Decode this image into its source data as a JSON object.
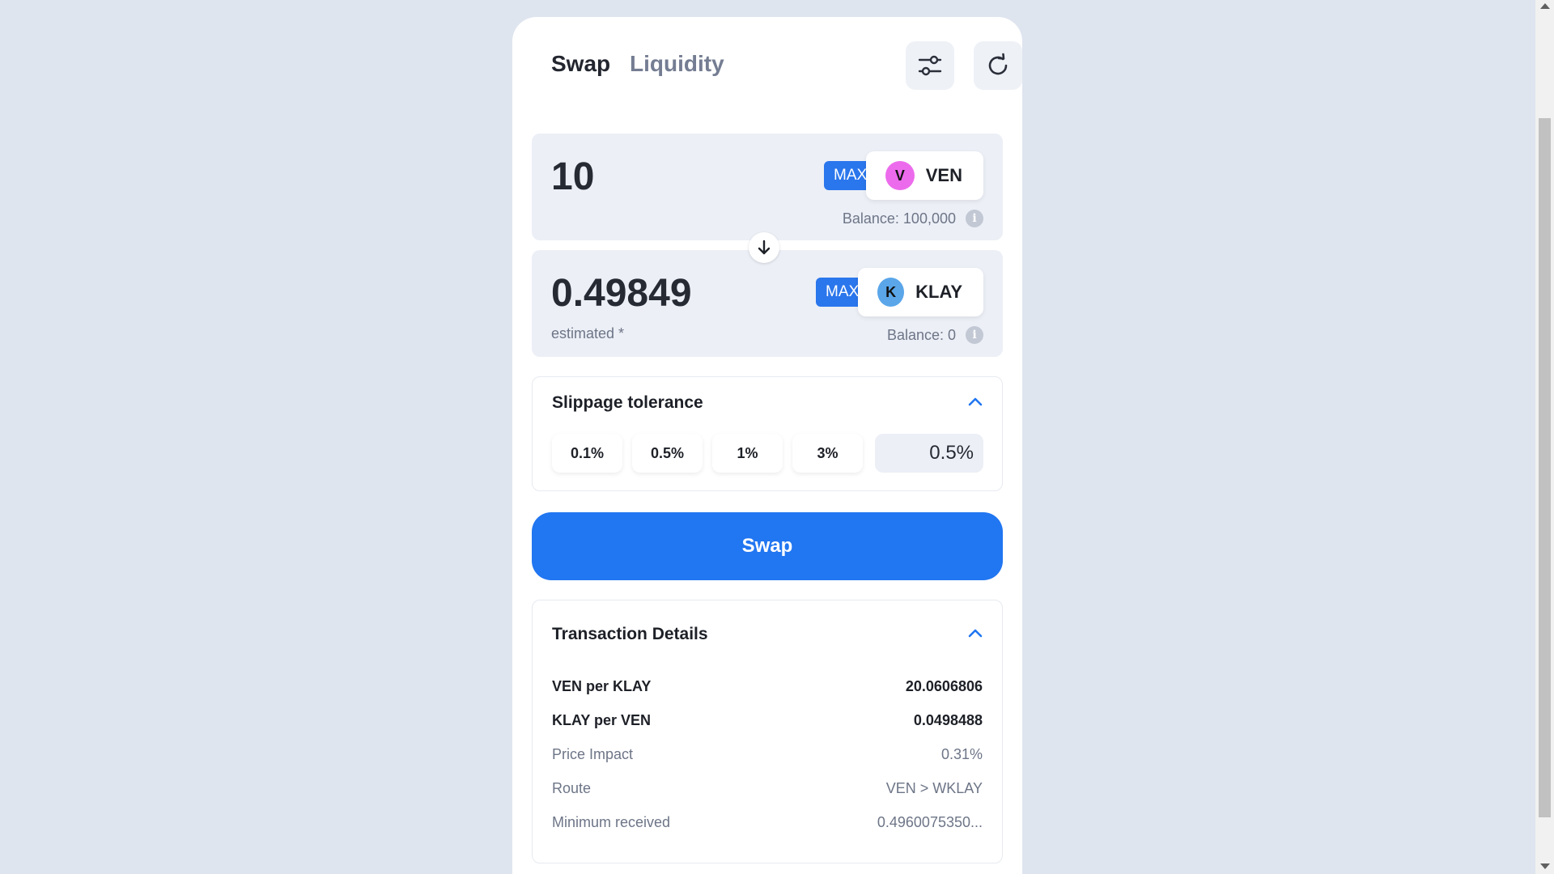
{
  "tabs": {
    "swap": "Swap",
    "liquidity": "Liquidity"
  },
  "from": {
    "amount": "10",
    "max_label": "MAX",
    "token": {
      "symbol": "VEN",
      "letter": "V",
      "color": "#ec6bec"
    },
    "balance": "Balance: 100,000"
  },
  "to": {
    "amount": "0.49849",
    "max_label": "MAX",
    "token": {
      "symbol": "KLAY",
      "letter": "K",
      "color": "#5aa6e9"
    },
    "estimated": "estimated *",
    "balance": "Balance: 0"
  },
  "slippage": {
    "title": "Slippage tolerance",
    "options": [
      "0.1%",
      "0.5%",
      "1%",
      "3%"
    ],
    "value": "0.5%"
  },
  "swap_button": "Swap",
  "details": {
    "title": "Transaction Details",
    "rows": [
      {
        "label": "VEN per KLAY",
        "value": "20.0606806"
      },
      {
        "label": "KLAY per VEN",
        "value": "0.0498488"
      },
      {
        "label": "Price Impact",
        "value": "0.31%"
      },
      {
        "label": "Route",
        "value": "VEN > WKLAY"
      },
      {
        "label": "Minimum received",
        "value": "0.4960075350..."
      }
    ]
  },
  "icons": {
    "settings": "sliders-icon",
    "refresh": "refresh-icon",
    "arrow": "arrow-down-icon",
    "info": "info-icon",
    "chevron": "chevron-up-icon"
  },
  "colors": {
    "accent": "#2176f1",
    "max": "#2a76ec",
    "background": "#dfe5ef"
  }
}
